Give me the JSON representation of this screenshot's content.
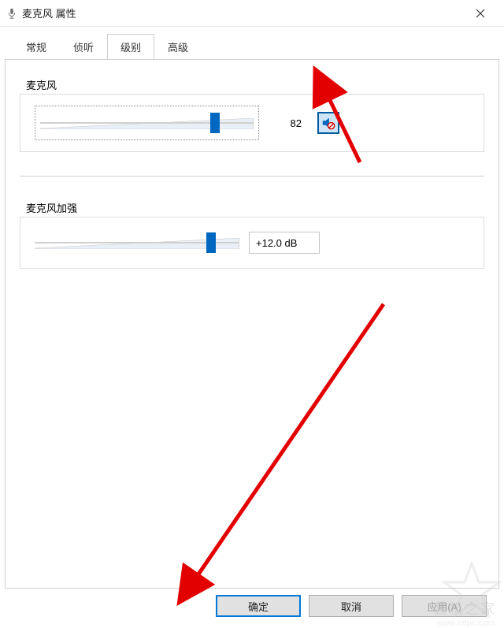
{
  "window": {
    "title": "麦克风 属性"
  },
  "tabs": {
    "items": [
      {
        "label": "常规"
      },
      {
        "label": "侦听"
      },
      {
        "label": "级别"
      },
      {
        "label": "高级"
      }
    ],
    "active_index": 2
  },
  "mic_level": {
    "group_label": "麦克风",
    "value": 82,
    "value_text": "82",
    "min": 0,
    "max": 100,
    "muted": true
  },
  "mic_boost": {
    "group_label": "麦克风加强",
    "value_percent": 86,
    "display": "+12.0 dB"
  },
  "buttons": {
    "ok": "确定",
    "cancel": "取消",
    "apply": "应用(A)"
  },
  "watermark": {
    "text": "装机之家",
    "url": "www.lotpc.com"
  }
}
